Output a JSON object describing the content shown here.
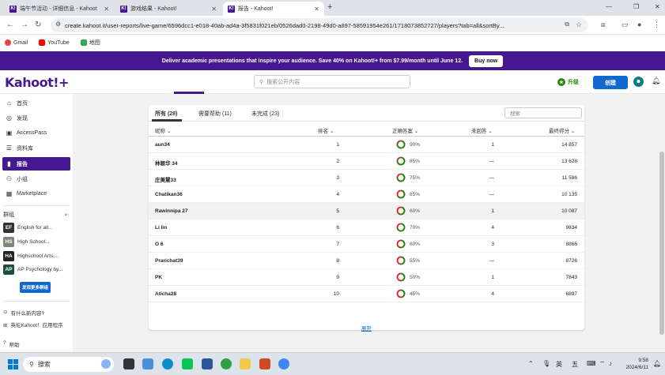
{
  "browser": {
    "tabs": [
      {
        "title": "端午节活动 - 详细信息 - Kahoot",
        "active": false
      },
      {
        "title": "游戏结果 - Kahoot!",
        "active": false
      },
      {
        "title": "报告 - Kahoot!",
        "active": true
      }
    ],
    "url": "create.kahoot.it/user-reports/live-game/6596dcc1-e018-40ab-ad4a-3f5831f021eb/0526dad0-2198-49d0-a897-58591954e261/1718073852727/players?tab=all&sortBy...",
    "bookmarks": [
      "Gmail",
      "YouTube",
      "地图"
    ]
  },
  "promo": {
    "text": "Deliver academic presentations that inspire your audience. Save 40% on Kahoot!+ from $7.99/month until June 12.",
    "button": "Buy now"
  },
  "header": {
    "logo": "Kahoot!+",
    "search_placeholder": "搜索公开内容",
    "upgrade": "升级",
    "create": "创建"
  },
  "sidebar": {
    "items": [
      {
        "label": "首页",
        "icon": "home-icon",
        "active": false
      },
      {
        "label": "发现",
        "icon": "compass-icon",
        "active": false
      },
      {
        "label": "AccessPass",
        "icon": "accesspass-icon",
        "active": false
      },
      {
        "label": "资料库",
        "icon": "library-icon",
        "active": false
      },
      {
        "label": "报告",
        "icon": "reports-icon",
        "active": true
      },
      {
        "label": "小组",
        "icon": "groups-icon",
        "active": false
      },
      {
        "label": "Marketplace",
        "icon": "marketplace-icon",
        "active": false
      }
    ],
    "groups_label": "群组",
    "groups": [
      {
        "abbr": "EF",
        "name": "English for all...",
        "color": "#333333"
      },
      {
        "abbr": "HS",
        "name": "High School...",
        "color": "#7a8a7a"
      },
      {
        "abbr": "HA",
        "name": "Highschool Arts,...",
        "color": "#222222"
      },
      {
        "abbr": "AP",
        "name": "AP Psychology by...",
        "color": "#1e4d3a"
      }
    ],
    "more_groups": "发现更多群组",
    "footer": [
      {
        "label": "有什么新内容?",
        "icon": "news-icon"
      },
      {
        "label": "英伦Kahoot！应用程序",
        "icon": "apps-icon"
      },
      {
        "label": "帮助",
        "icon": "help-icon"
      }
    ]
  },
  "report": {
    "filter_tabs": [
      {
        "label": "所有 (28)",
        "active": true
      },
      {
        "label": "需要帮助 (11)",
        "active": false
      },
      {
        "label": "未完成 (23)",
        "active": false
      }
    ],
    "search_placeholder": "搜索",
    "columns": {
      "name": "昵称",
      "rank": "排名",
      "correct": "正确答案",
      "unanswered": "未回答",
      "score": "最终得分"
    },
    "players": [
      {
        "name": "aun34",
        "rank": "1",
        "correct": 90,
        "unanswered": "1",
        "score": "14 857"
      },
      {
        "name": "林颖华 34",
        "rank": "2",
        "correct": 85,
        "unanswered": "—",
        "score": "13 628"
      },
      {
        "name": "庄美慧33",
        "rank": "3",
        "correct": 75,
        "unanswered": "—",
        "score": "11 586"
      },
      {
        "name": "Chatikan36",
        "rank": "4",
        "correct": 65,
        "unanswered": "—",
        "score": "10 135"
      },
      {
        "name": "Rawinnipa 27",
        "rank": "5",
        "correct": 60,
        "unanswered": "1",
        "score": "10 087"
      },
      {
        "name": "Li lin",
        "rank": "6",
        "correct": 70,
        "unanswered": "4",
        "score": "9834"
      },
      {
        "name": "O 6",
        "rank": "7",
        "correct": 60,
        "unanswered": "3",
        "score": "8866"
      },
      {
        "name": "Prarichat39",
        "rank": "8",
        "correct": 55,
        "unanswered": "—",
        "score": "8726"
      },
      {
        "name": "PK",
        "rank": "9",
        "correct": 50,
        "unanswered": "1",
        "score": "7843"
      },
      {
        "name": "Aticha28",
        "rank": "10",
        "correct": 45,
        "unanswered": "4",
        "score": "6897"
      }
    ],
    "show_more": "展开",
    "colors": {
      "correct": "#26890c",
      "incorrect": "#e21b3c"
    }
  },
  "taskbar": {
    "search": "搜索",
    "ime": [
      "英",
      "五"
    ],
    "time": "9:58",
    "date": "2024/6/11"
  }
}
